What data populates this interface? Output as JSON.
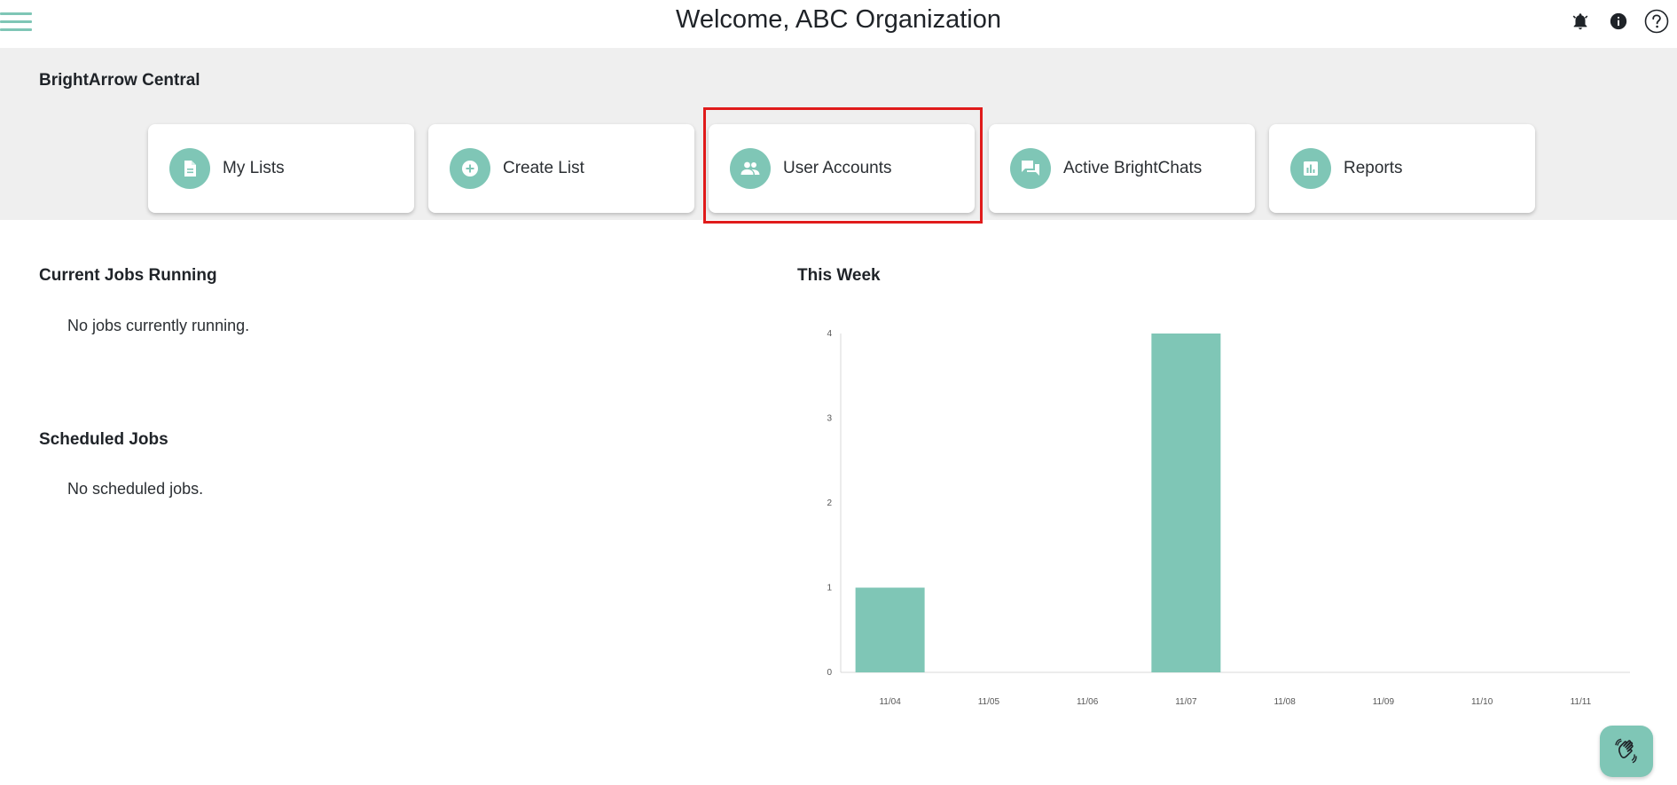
{
  "header": {
    "title": "Welcome, ABC Organization",
    "icons": [
      "menu-icon",
      "bell-icon",
      "info-icon",
      "help-icon"
    ]
  },
  "central": {
    "title": "BrightArrow Central",
    "cards": [
      {
        "label": "My Lists",
        "icon": "document-icon"
      },
      {
        "label": "Create List",
        "icon": "plus-circle-icon"
      },
      {
        "label": "User Accounts",
        "icon": "users-icon"
      },
      {
        "label": "Active BrightChats",
        "icon": "chat-icon"
      },
      {
        "label": "Reports",
        "icon": "bar-chart-icon"
      }
    ],
    "highlighted_card": "User Accounts"
  },
  "jobs": {
    "current_title": "Current Jobs Running",
    "current_text": "No jobs currently running.",
    "scheduled_title": "Scheduled Jobs",
    "scheduled_text": "No scheduled jobs."
  },
  "week": {
    "title": "This Week"
  },
  "colors": {
    "accent": "#7fc6b6",
    "band": "#efefef",
    "highlight": "#e01b1b"
  },
  "chart_data": {
    "type": "bar",
    "categories": [
      "11/04",
      "11/05",
      "11/06",
      "11/07",
      "11/08",
      "11/09",
      "11/10",
      "11/11"
    ],
    "values": [
      1,
      0,
      0,
      4,
      0,
      0,
      0,
      0
    ],
    "yticks": [
      0,
      1,
      2,
      3,
      4
    ],
    "ylim": [
      0,
      4
    ],
    "title": "This Week",
    "grid": false,
    "legend": "none",
    "color": "#7fc6b6"
  }
}
